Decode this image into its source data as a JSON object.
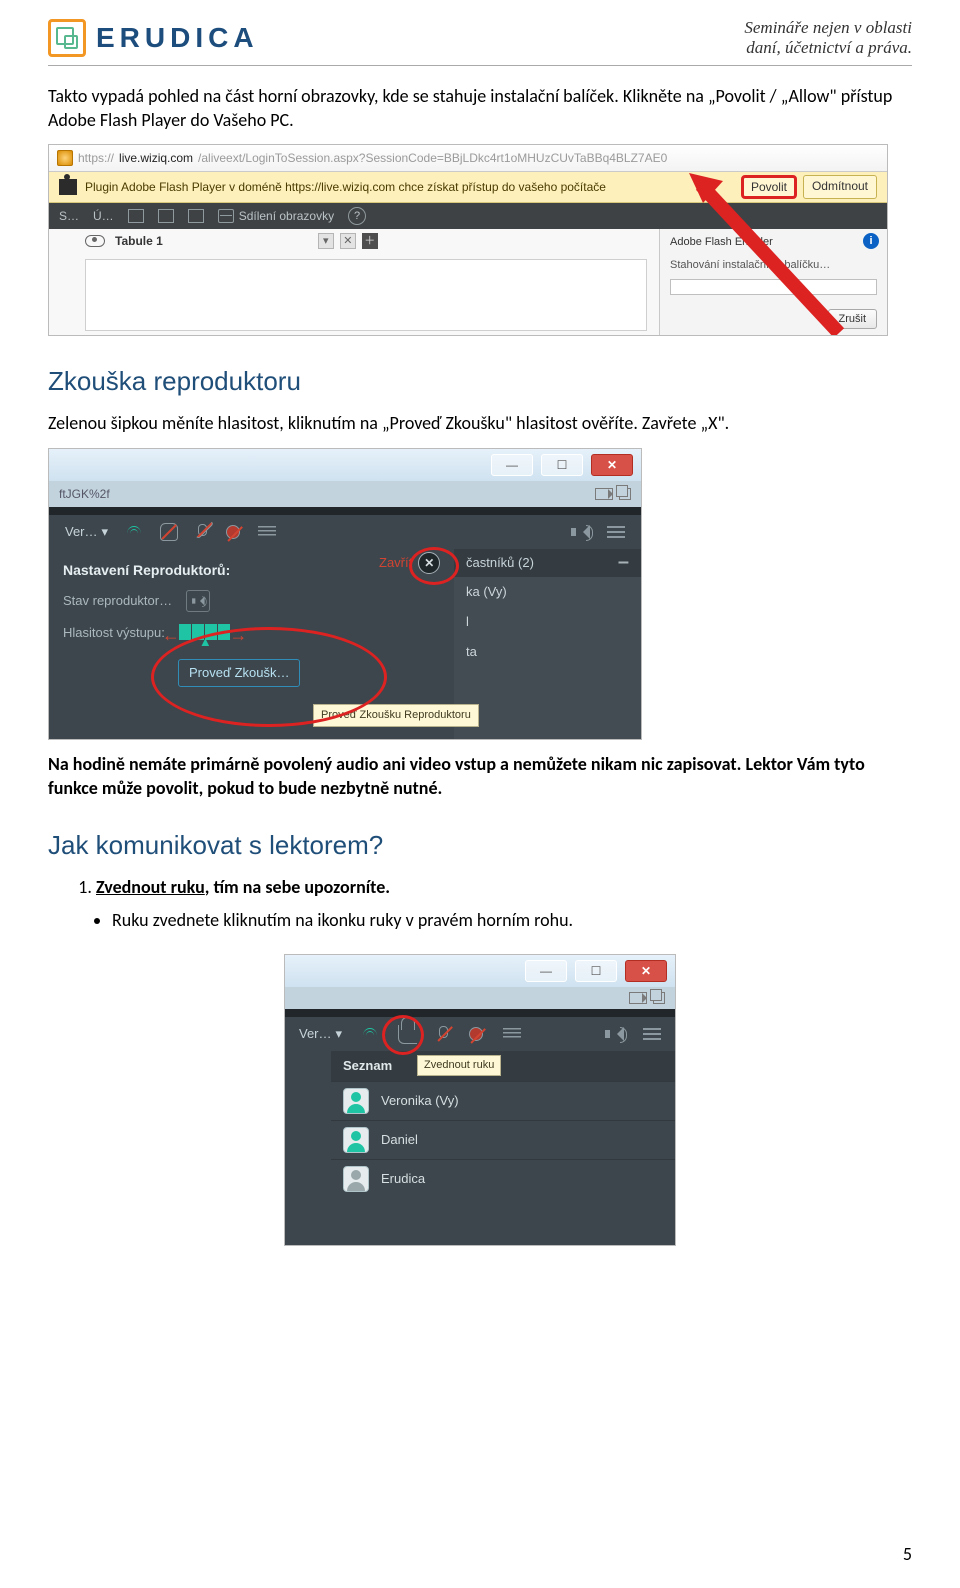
{
  "header": {
    "brand": "ERUDICA",
    "tagline_l1": "Semináře nejen v oblasti",
    "tagline_l2": "daní, účetnictví a práva."
  },
  "intro": {
    "p1a": "Takto vypadá pohled na část horní obrazovky, kde se stahuje instalační balíček. Klikněte na „Povolit / „Allow\" přístup Adobe Flash Player do Vašeho PC."
  },
  "ss1": {
    "url_gray1": "https://",
    "url_black": "live.wiziq.com",
    "url_gray2": "/aliveext/LoginToSession.aspx?SessionCode=BBjLDkc4rt1oMHUzCUvTaBBq4BLZ7AE0",
    "plugin_msg": "Plugin Adobe Flash Player v doméně https://live.wiziq.com chce získat přístup do vašeho počítače",
    "allow": "Povolit",
    "deny": "Odmítnout",
    "tb_s": "S…",
    "tb_u": "Ú…",
    "tb_screen": "Sdílení obrazovky",
    "tab_name": "Tabule 1",
    "enabler_title": "Adobe Flash Enabler",
    "enabler_status": "Stahování instalačního balíčku…",
    "enabler_cancel": "Zrušit"
  },
  "sec2": {
    "heading": "Zkouška reproduktoru",
    "p": "Zelenou šipkou měníte hlasitost, kliknutím na „Proveď Zkoušku\" hlasitost ověříte. Zavřete „X\"."
  },
  "ss2": {
    "tab": "ftJGK%2f",
    "ver": "Ver…",
    "panel_title": "Nastavení Reproduktorů:",
    "row_status": "Stav reproduktor…",
    "row_vol": "Hlasitost výstupu:",
    "test_btn": "Proveď Zkoušk…",
    "close_label": "Zavřít",
    "right_hdr": "častníků (2)",
    "right_items": [
      "ka (Vy)",
      "l",
      "ta"
    ],
    "tooltip": "Proveď Zkoušku Reproduktoru"
  },
  "mid": {
    "p1": "Na hodině nemáte primárně povolený audio ani video vstup a nemůžete nikam nic zapisovat. Lektor Vám tyto funkce může povolit, pokud to bude nezbytně nutné.",
    "heading": "Jak komunikovat s lektorem?",
    "li1a": "Zvednout ruku",
    "li1b": ", tím na sebe upozorníte.",
    "bul1": "Ruku zvednete kliknutím na ikonku ruky v pravém horním rohu."
  },
  "ss3": {
    "ver": "Ver…",
    "hdr": "Seznam",
    "tooltip": "Zvednout ruku",
    "rows": [
      "Veronika (Vy)",
      "Daniel",
      "Erudica"
    ]
  },
  "page_number": "5"
}
